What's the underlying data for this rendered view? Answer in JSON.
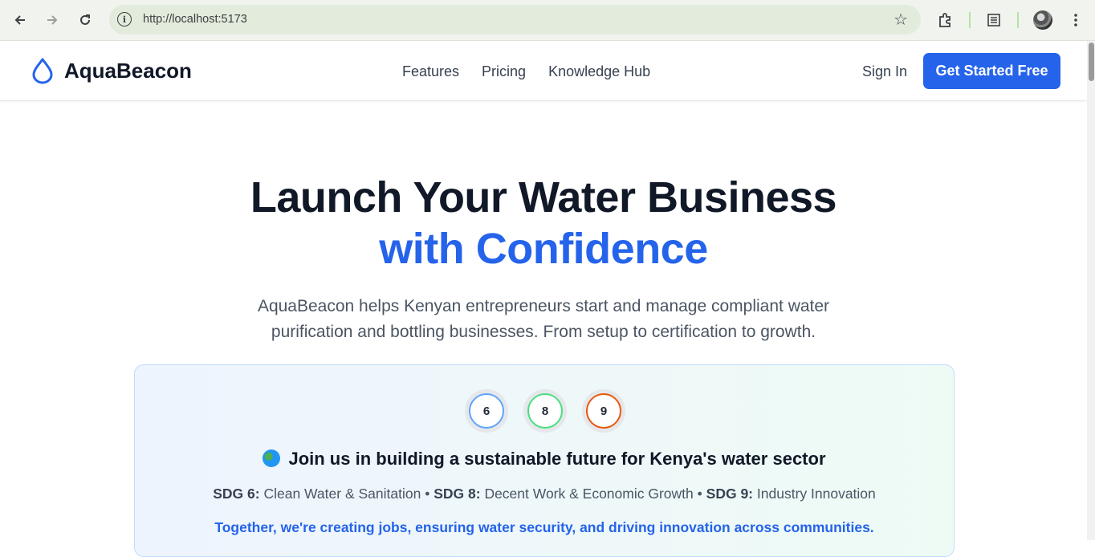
{
  "browser": {
    "url": "http://localhost:5173",
    "back_icon": "arrow-left-icon",
    "forward_icon": "arrow-right-icon",
    "reload_icon": "reload-icon",
    "bookmark_icon": "star-icon",
    "extensions_icon": "puzzle-icon",
    "reading_list_icon": "reading-list-icon",
    "menu_icon": "kebab-icon"
  },
  "header": {
    "brand": "AquaBeacon",
    "logo_icon": "water-drop-icon",
    "nav": [
      "Features",
      "Pricing",
      "Knowledge Hub"
    ],
    "sign_in": "Sign In",
    "cta": "Get Started Free",
    "accent_color": "#2563eb"
  },
  "hero": {
    "title_line1": "Launch Your Water Business",
    "title_line2": "with Confidence",
    "subtitle": "AquaBeacon helps Kenyan entrepreneurs start and manage compliant water purification and bottling businesses. From setup to certification to growth."
  },
  "sdg_card": {
    "badges": [
      {
        "number": "6",
        "color": "#60a5fa"
      },
      {
        "number": "8",
        "color": "#4ade80"
      },
      {
        "number": "9",
        "color": "#ea580c"
      }
    ],
    "title": "Join us in building a sustainable future for Kenya's water sector",
    "globe_icon": "globe-icon",
    "sdgs": [
      {
        "label": "SDG 6:",
        "text": "Clean Water & Sanitation"
      },
      {
        "label": "SDG 8:",
        "text": "Decent Work & Economic Growth"
      },
      {
        "label": "SDG 9:",
        "text": "Industry Innovation"
      }
    ],
    "separator": "•",
    "tagline": "Together, we're creating jobs, ensuring water security, and driving innovation across communities."
  }
}
